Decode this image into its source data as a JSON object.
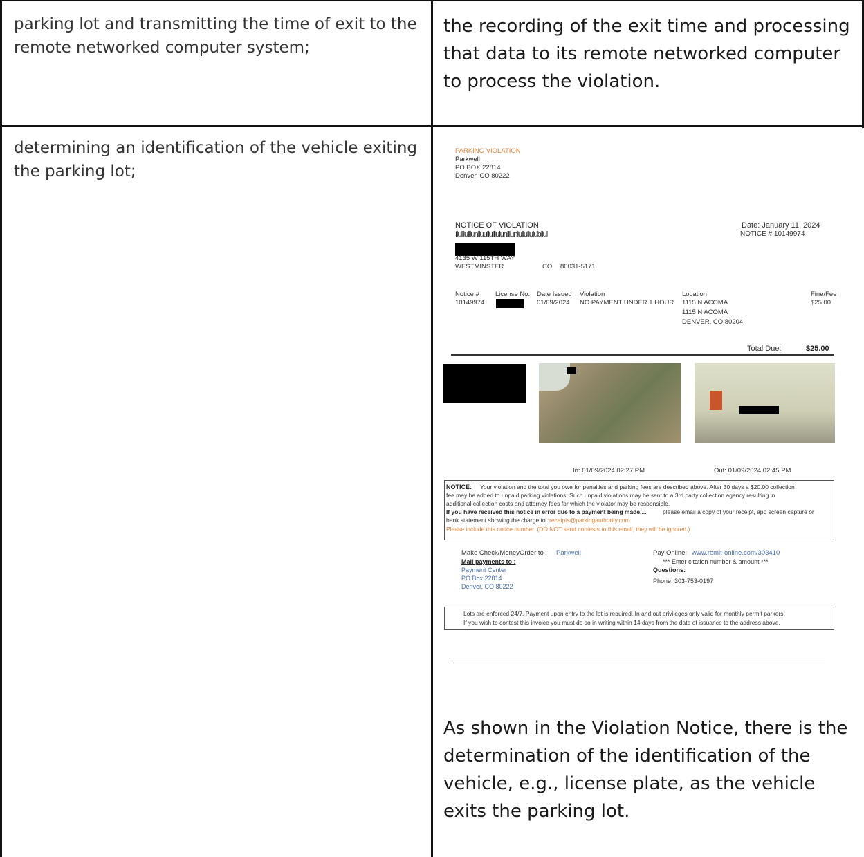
{
  "row1": {
    "left": "parking lot and transmitting the time of exit to the remote networked computer system;",
    "right": "the recording of the exit time and processing that data to its remote networked computer to process the violation."
  },
  "row2": {
    "left": "determining an identification of the vehicle exiting the parking lot;",
    "right": "As shown in the Violation Notice, there is the determination of the identification of the vehicle, e.g., license plate, as the vehicle exits the parking lot."
  },
  "notice": {
    "header_tag": "PARKING VIOLATION",
    "company": "Parkwell",
    "pobox": "PO BOX 22814",
    "city": "Denver, CO 80222",
    "title": "NOTICE OF VIOLATION",
    "barcode": "Ilulllulllunlluullulilulunlllunlullullulubllul",
    "date": "Date: January 11, 2024",
    "notice_no": "NOTICE #   10149974",
    "addr_line": "4135 W 115TH WAY",
    "addr_city": "WESTMINSTER",
    "addr_state": "CO",
    "addr_zip": "80031-5171",
    "table": {
      "headers": [
        "Notice #",
        "License No.",
        "Date Issued",
        "Violation",
        "Location",
        "Fine/Fee"
      ],
      "row": {
        "notice": "10149974",
        "date": "01/09/2024",
        "violation": "NO PAYMENT UNDER 1 HOUR",
        "loc1": "1115 N ACOMA",
        "loc2": "1115 N ACOMA",
        "loc3": "DENVER, CO 80204",
        "fee": "$25.00"
      }
    },
    "total_label": "Total Due:",
    "total_value": "$25.00",
    "in_time": "In: 01/09/2024 02:27 PM",
    "out_time": "Out: 01/09/2024 02:45 PM",
    "notice_label": "NOTICE:",
    "notice_text1": "Your violation and the total you owe for penalties and parking fees are described above.  After 30 days a $20.00 collection",
    "notice_text2": "fee may be added to unpaid parking violations.  Such unpaid violations may be sent to a 3rd party collection agency resulting in",
    "notice_text3": "additional collection costs and attorney fees for which the violator may be responsible.",
    "notice_bold": "If you have received this notice in error due to a payment being made....",
    "notice_text4": "please email a copy of your receipt, app screen capture or",
    "notice_text5": "bank statement showing the charge to :",
    "receipts_email": "receipts@parkingauthority.com",
    "notice_warn": "Please include this notice number. (DO NOT send contests to this email, they will be ignored.)",
    "make_check": "Make Check/MoneyOrder to :",
    "make_check_to": "Parkwell",
    "mail_payments": "Mail payments to :",
    "pay_center": "Payment Center",
    "pay_box": "PO Box 22814",
    "pay_city": "Denver, CO 80222",
    "pay_online": "Pay Online:",
    "pay_url": "www.remit-online.com/303410",
    "enter_citation": "*** Enter citation number & amount ***",
    "questions": "Questions:",
    "phone": "Phone:  303-753-0197",
    "footer1": "Lots are enforced 24/7.  Payment upon entry to the lot is required. In and out privileges only valid for monthly permit parkers.",
    "footer2": "If you wish to contest this invoice you must do so in writing within 14 days from the date of issuance to the address above."
  },
  "colors": {
    "orange": "#e8833a",
    "blue": "#4a6fb5",
    "border": "#111111"
  }
}
